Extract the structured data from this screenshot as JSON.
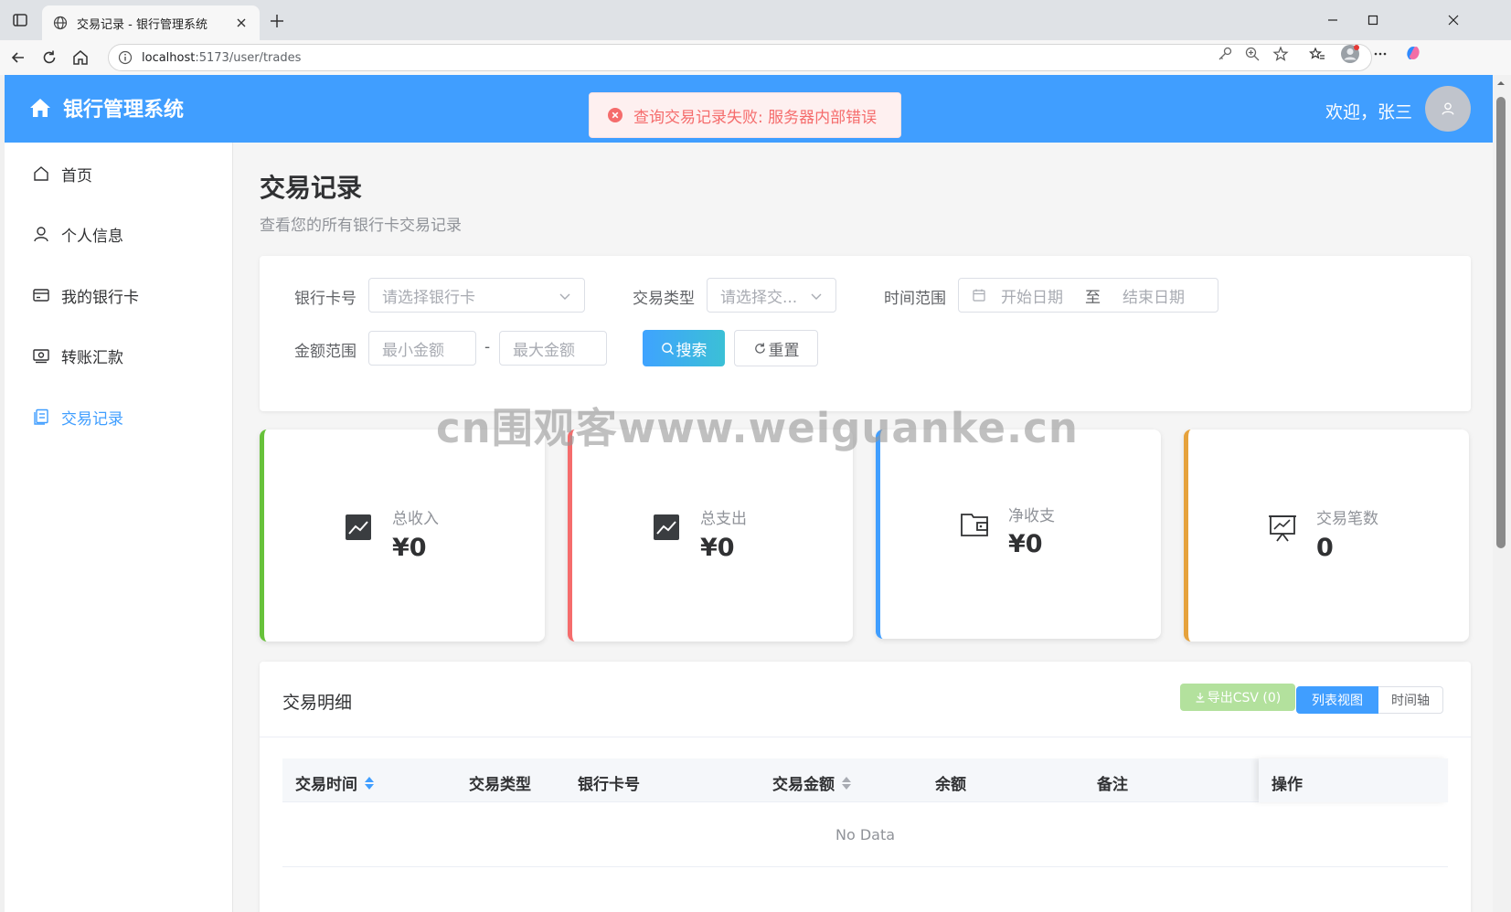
{
  "browser": {
    "tab_title": "交易记录 - 银行管理系统",
    "url_host": "localhost",
    "url_path": ":5173/user/trades"
  },
  "header": {
    "brand": "银行管理系统",
    "welcome": "欢迎，张三"
  },
  "toast": {
    "message": "查询交易记录失败: 服务器内部错误"
  },
  "sidebar": {
    "items": [
      {
        "label": "首页",
        "icon": "home-icon"
      },
      {
        "label": "个人信息",
        "icon": "user-icon"
      },
      {
        "label": "我的银行卡",
        "icon": "card-icon"
      },
      {
        "label": "转账汇款",
        "icon": "money-icon"
      },
      {
        "label": "交易记录",
        "icon": "document-icon",
        "active": true
      }
    ]
  },
  "page": {
    "title": "交易记录",
    "subtitle": "查看您的所有银行卡交易记录"
  },
  "filters": {
    "card_label": "银行卡号",
    "card_placeholder": "请选择银行卡",
    "type_label": "交易类型",
    "type_placeholder": "请选择交...",
    "time_label": "时间范围",
    "start_placeholder": "开始日期",
    "range_separator": "至",
    "end_placeholder": "结束日期",
    "amount_label": "金额范围",
    "min_placeholder": "最小金额",
    "amount_dash": "-",
    "max_placeholder": "最大金额",
    "search_button": "搜索",
    "reset_button": "重置"
  },
  "stats": [
    {
      "label": "总收入",
      "value": "¥0",
      "color": "#67c23a",
      "icon": "trend-icon"
    },
    {
      "label": "总支出",
      "value": "¥0",
      "color": "#f56c6c",
      "icon": "trend-icon"
    },
    {
      "label": "净收支",
      "value": "¥0",
      "color": "#409eff",
      "icon": "wallet-icon"
    },
    {
      "label": "交易笔数",
      "value": "0",
      "color": "#e6a23c",
      "icon": "presentation-icon"
    }
  ],
  "detail": {
    "title": "交易明细",
    "export_button": "导出CSV (0)",
    "view_list": "列表视图",
    "view_timeline": "时间轴",
    "columns": [
      "交易时间",
      "交易类型",
      "银行卡号",
      "交易金额",
      "余额",
      "备注",
      "操作"
    ],
    "empty_text": "No Data"
  },
  "watermark": "cn围观客www.weiguanke.cn"
}
